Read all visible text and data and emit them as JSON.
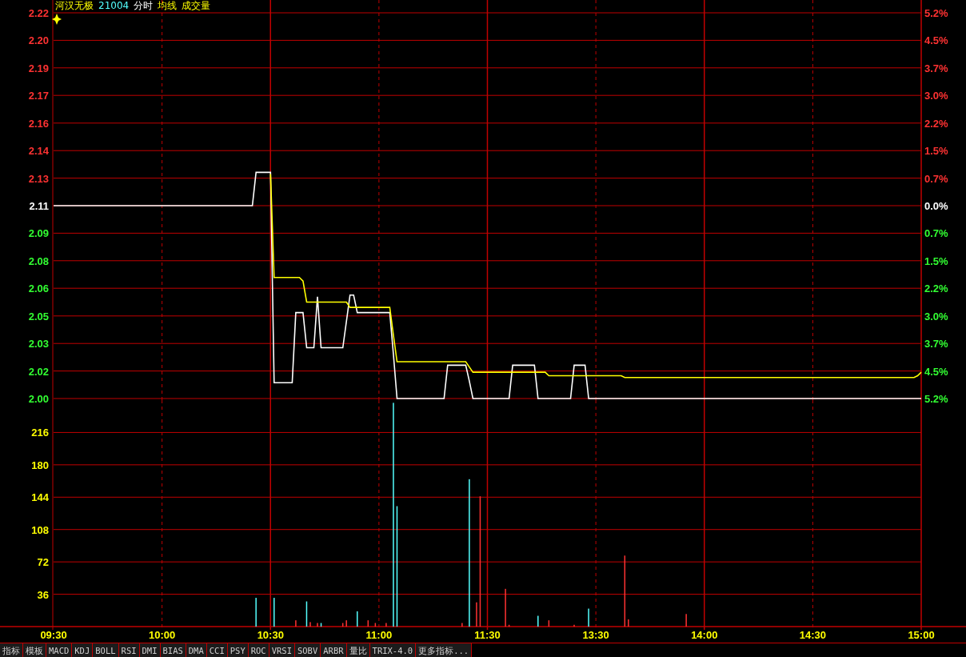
{
  "header": [
    {
      "text": "河汉无极",
      "color": "#ffff00"
    },
    {
      "text": "21004",
      "color": "#54ffff"
    }
  ],
  "price_chart": {
    "percent_labels": [
      "5.2%",
      "4.5%",
      "3.7%",
      "3.0%",
      "2.2%",
      "1.5%",
      "0.7%",
      "0.0%",
      "0.7%",
      "1.5%",
      "2.2%",
      "3.0%",
      "3.7%",
      "4.5%",
      "5.2%"
    ],
    "chart_data": {
      "type": "line",
      "grid": true,
      "categories": [
        null,
        null,
        null,
        null,
        null,
        null,
        null,
        null,
        null,
        null,
        null,
        null,
        null,
        null,
        null,
        null,
        null,
        null,
        null,
        null,
        null,
        null,
        null,
        null,
        null,
        null,
        null,
        null,
        null,
        null,
        null,
        null,
        null,
        null,
        null,
        null,
        null,
        null,
        null,
        null,
        null,
        null,
        null,
        null,
        null,
        null,
        null,
        null,
        null,
        null,
        null,
        null,
        null,
        null,
        null,
        null,
        null,
        null,
        null,
        null,
        null,
        null,
        null,
        null,
        null,
        null,
        null,
        null,
        null,
        null,
        null,
        null,
        null,
        null,
        null,
        null,
        null,
        null,
        null,
        null,
        null,
        null,
        null,
        null,
        null,
        null,
        null,
        null,
        null,
        null,
        null,
        null,
        null,
        null,
        null,
        null,
        null,
        null,
        null,
        null,
        null,
        null,
        null,
        null,
        null,
        null,
        null,
        null,
        null,
        null,
        null,
        null,
        null,
        null,
        null,
        null,
        null,
        null,
        null,
        null,
        null,
        null,
        null,
        null,
        null,
        null,
        null,
        null,
        null,
        null,
        null,
        null,
        null,
        null,
        null,
        null,
        null,
        null,
        null,
        null,
        null,
        null,
        null,
        null,
        null,
        null,
        null,
        null,
        null,
        null,
        null,
        null,
        null,
        null,
        null,
        null,
        null,
        null,
        null,
        null,
        null,
        null,
        null,
        null,
        null,
        null,
        null,
        null,
        null,
        null,
        null,
        null,
        null,
        null,
        null,
        null,
        null,
        null,
        null,
        null,
        null,
        null,
        null,
        null,
        null,
        null,
        null,
        null,
        null,
        null,
        null,
        null,
        null,
        null,
        null,
        null,
        null,
        null,
        null,
        null,
        null,
        null,
        null,
        null,
        null,
        null,
        null,
        null,
        null,
        null,
        null,
        null,
        null,
        null,
        null,
        null,
        null,
        null,
        null,
        null,
        null,
        null,
        null,
        null,
        null,
        null,
        null,
        null,
        null,
        null,
        null,
        null,
        null,
        null,
        null,
        null,
        null,
        null,
        null,
        null,
        null
      ],
      "ylim": [
        2.0,
        2.22
      ],
      "yticks": [
        {
          "value": 2.22,
          "label": "2.22"
        },
        {
          "value": 2.2043,
          "label": "2.20"
        },
        {
          "value": 2.1886,
          "label": "2.19"
        },
        {
          "value": 2.1729,
          "label": "2.17"
        },
        {
          "value": 2.1571,
          "label": "2.16"
        },
        {
          "value": 2.1414,
          "label": "2.14"
        },
        {
          "value": 2.1257,
          "label": "2.13"
        },
        {
          "value": 2.11,
          "label": "2.11"
        },
        {
          "value": 2.0943,
          "label": "2.09"
        },
        {
          "value": 2.0786,
          "label": "2.08"
        },
        {
          "value": 2.0629,
          "label": "2.06"
        },
        {
          "value": 2.0471,
          "label": "2.05"
        },
        {
          "value": 2.0314,
          "label": "2.03"
        },
        {
          "value": 2.0157,
          "label": "2.02"
        },
        {
          "value": 2.0,
          "label": "2.00"
        }
      ],
      "series": [
        {
          "name": "分时",
          "color": "#ffffff",
          "values": [
            2.11,
            2.11,
            2.11,
            2.11,
            2.11,
            2.11,
            2.11,
            2.11,
            2.11,
            2.11,
            2.11,
            2.11,
            2.11,
            2.11,
            2.11,
            2.11,
            2.11,
            2.11,
            2.11,
            2.11,
            2.11,
            2.11,
            2.11,
            2.11,
            2.11,
            2.11,
            2.11,
            2.11,
            2.11,
            2.11,
            2.11,
            2.11,
            2.11,
            2.11,
            2.11,
            2.11,
            2.11,
            2.11,
            2.11,
            2.11,
            2.11,
            2.11,
            2.11,
            2.11,
            2.11,
            2.11,
            2.11,
            2.11,
            2.11,
            2.11,
            2.11,
            2.11,
            2.11,
            2.11,
            2.11,
            2.11,
            2.129,
            2.129,
            2.129,
            2.129,
            2.129,
            2.009,
            2.009,
            2.009,
            2.009,
            2.009,
            2.009,
            2.049,
            2.049,
            2.049,
            2.029,
            2.029,
            2.029,
            2.058,
            2.029,
            2.029,
            2.029,
            2.029,
            2.029,
            2.029,
            2.029,
            2.044,
            2.059,
            2.059,
            2.049,
            2.049,
            2.049,
            2.049,
            2.049,
            2.049,
            2.049,
            2.049,
            2.049,
            2.049,
            2.025,
            2.0,
            2.0,
            2.0,
            2.0,
            2.0,
            2.0,
            2.0,
            2.0,
            2.0,
            2.0,
            2.0,
            2.0,
            2.0,
            2.0,
            2.019,
            2.019,
            2.019,
            2.019,
            2.019,
            2.019,
            2.01,
            2.0,
            2.0,
            2.0,
            2.0,
            2.0,
            2.0,
            2.0,
            2.0,
            2.0,
            2.0,
            2.0,
            2.019,
            2.019,
            2.019,
            2.019,
            2.019,
            2.019,
            2.019,
            2.0,
            2.0,
            2.0,
            2.0,
            2.0,
            2.0,
            2.0,
            2.0,
            2.0,
            2.0,
            2.019,
            2.019,
            2.019,
            2.019,
            2.0,
            2.0,
            2.0,
            2.0,
            2.0,
            2.0,
            2.0,
            2.0,
            2.0,
            2.0,
            2.0,
            2.0,
            2.0,
            2.0,
            2.0,
            2.0,
            2.0,
            2.0,
            2.0,
            2.0,
            2.0,
            2.0,
            2.0,
            2.0,
            2.0,
            2.0,
            2.0,
            2.0,
            2.0,
            2.0,
            2.0,
            2.0,
            2.0,
            2.0,
            2.0,
            2.0,
            2.0,
            2.0,
            2.0,
            2.0,
            2.0,
            2.0,
            2.0,
            2.0,
            2.0,
            2.0,
            2.0,
            2.0,
            2.0,
            2.0,
            2.0,
            2.0,
            2.0,
            2.0,
            2.0,
            2.0,
            2.0,
            2.0,
            2.0,
            2.0,
            2.0,
            2.0,
            2.0,
            2.0,
            2.0,
            2.0,
            2.0,
            2.0,
            2.0,
            2.0,
            2.0,
            2.0,
            2.0,
            2.0,
            2.0,
            2.0,
            2.0,
            2.0,
            2.0,
            2.0,
            2.0,
            2.0,
            2.0,
            2.0,
            2.0,
            2.0,
            2.0,
            2.0,
            2.0,
            2.0,
            2.0,
            2.0,
            2.0
          ]
        },
        {
          "name": "均线",
          "color": "#ffff00",
          "values": [
            null,
            null,
            null,
            null,
            null,
            null,
            null,
            null,
            null,
            null,
            null,
            null,
            null,
            null,
            null,
            null,
            null,
            null,
            null,
            null,
            null,
            null,
            null,
            null,
            null,
            null,
            null,
            null,
            null,
            null,
            null,
            null,
            null,
            null,
            null,
            null,
            null,
            null,
            null,
            null,
            null,
            null,
            null,
            null,
            null,
            null,
            null,
            null,
            null,
            null,
            null,
            null,
            null,
            null,
            null,
            null,
            null,
            null,
            null,
            null,
            2.128,
            2.069,
            2.069,
            2.069,
            2.069,
            2.069,
            2.069,
            2.069,
            2.069,
            2.067,
            2.055,
            2.055,
            2.055,
            2.055,
            2.055,
            2.055,
            2.055,
            2.055,
            2.055,
            2.055,
            2.055,
            2.055,
            2.052,
            2.052,
            2.052,
            2.052,
            2.052,
            2.052,
            2.052,
            2.052,
            2.052,
            2.052,
            2.052,
            2.052,
            2.036,
            2.021,
            2.021,
            2.021,
            2.021,
            2.021,
            2.021,
            2.021,
            2.021,
            2.021,
            2.021,
            2.021,
            2.021,
            2.021,
            2.021,
            2.021,
            2.021,
            2.021,
            2.021,
            2.021,
            2.021,
            2.018,
            2.015,
            2.015,
            2.015,
            2.015,
            2.015,
            2.015,
            2.015,
            2.015,
            2.015,
            2.015,
            2.015,
            2.015,
            2.015,
            2.015,
            2.015,
            2.015,
            2.015,
            2.015,
            2.015,
            2.015,
            2.015,
            2.013,
            2.013,
            2.013,
            2.013,
            2.013,
            2.013,
            2.013,
            2.013,
            2.013,
            2.013,
            2.013,
            2.013,
            2.013,
            2.013,
            2.013,
            2.013,
            2.013,
            2.013,
            2.013,
            2.013,
            2.013,
            2.012,
            2.012,
            2.012,
            2.012,
            2.012,
            2.012,
            2.012,
            2.012,
            2.012,
            2.012,
            2.012,
            2.012,
            2.012,
            2.012,
            2.012,
            2.012,
            2.012,
            2.012,
            2.012,
            2.012,
            2.012,
            2.012,
            2.012,
            2.012,
            2.012,
            2.012,
            2.012,
            2.012,
            2.012,
            2.012,
            2.012,
            2.012,
            2.012,
            2.012,
            2.012,
            2.012,
            2.012,
            2.012,
            2.012,
            2.012,
            2.012,
            2.012,
            2.012,
            2.012,
            2.012,
            2.012,
            2.012,
            2.012,
            2.012,
            2.012,
            2.012,
            2.012,
            2.012,
            2.012,
            2.012,
            2.012,
            2.012,
            2.012,
            2.012,
            2.012,
            2.012,
            2.012,
            2.012,
            2.012,
            2.012,
            2.012,
            2.012,
            2.012,
            2.012,
            2.012,
            2.012,
            2.012,
            2.012,
            2.012,
            2.012,
            2.012,
            2.012,
            2.012,
            2.012,
            2.012,
            2.012,
            2.013,
            2.015
          ]
        }
      ]
    }
  },
  "volume_chart": {
    "chart_data": {
      "type": "bar",
      "title": "成交量",
      "grid": true,
      "categories": [
        "09:30",
        null,
        null,
        null,
        null,
        null,
        null,
        null,
        null,
        null,
        null,
        null,
        null,
        null,
        null,
        null,
        null,
        null,
        null,
        null,
        null,
        null,
        null,
        null,
        null,
        null,
        null,
        null,
        null,
        null,
        "10:00",
        null,
        null,
        null,
        null,
        null,
        null,
        null,
        null,
        null,
        null,
        null,
        null,
        null,
        null,
        null,
        null,
        null,
        null,
        null,
        null,
        null,
        null,
        null,
        null,
        null,
        null,
        null,
        null,
        null,
        "10:30",
        null,
        null,
        null,
        null,
        null,
        null,
        null,
        null,
        null,
        null,
        null,
        null,
        null,
        null,
        null,
        null,
        null,
        null,
        null,
        null,
        null,
        null,
        null,
        null,
        null,
        null,
        null,
        null,
        null,
        "11:00",
        null,
        null,
        null,
        null,
        null,
        null,
        null,
        null,
        null,
        null,
        null,
        null,
        null,
        null,
        null,
        null,
        null,
        null,
        null,
        null,
        null,
        null,
        null,
        null,
        null,
        null,
        null,
        null,
        null,
        "11:30",
        null,
        null,
        null,
        null,
        null,
        null,
        null,
        null,
        null,
        null,
        null,
        null,
        null,
        null,
        null,
        null,
        null,
        null,
        null,
        null,
        null,
        null,
        null,
        null,
        null,
        null,
        null,
        null,
        null,
        "13:30",
        null,
        null,
        null,
        null,
        null,
        null,
        null,
        null,
        null,
        null,
        null,
        null,
        null,
        null,
        null,
        null,
        null,
        null,
        null,
        null,
        null,
        null,
        null,
        null,
        null,
        null,
        null,
        null,
        null,
        "14:00",
        null,
        null,
        null,
        null,
        null,
        null,
        null,
        null,
        null,
        null,
        null,
        null,
        null,
        null,
        null,
        null,
        null,
        null,
        null,
        null,
        null,
        null,
        null,
        null,
        null,
        null,
        null,
        null,
        null,
        "14:30",
        null,
        null,
        null,
        null,
        null,
        null,
        null,
        null,
        null,
        null,
        null,
        null,
        null,
        null,
        null,
        null,
        null,
        null,
        null,
        null,
        null,
        null,
        null,
        null,
        null,
        null,
        null,
        null,
        null,
        "15:00"
      ],
      "ylim": [
        0,
        252
      ],
      "yticks": [
        36,
        72,
        108,
        144,
        180,
        216
      ],
      "series": [
        {
          "color": "#ff3232",
          "values": [
            null,
            null,
            null,
            null,
            null,
            null,
            null,
            null,
            null,
            null,
            null,
            null,
            null,
            null,
            null,
            null,
            null,
            null,
            null,
            null,
            null,
            null,
            null,
            null,
            null,
            null,
            null,
            null,
            null,
            null,
            null,
            null,
            null,
            null,
            null,
            null,
            null,
            null,
            null,
            null,
            null,
            null,
            null,
            null,
            null,
            null,
            null,
            null,
            null,
            null,
            null,
            null,
            null,
            null,
            null,
            null,
            null,
            null,
            null,
            null,
            null,
            null,
            null,
            null,
            null,
            null,
            null,
            7,
            null,
            null,
            null,
            5,
            null,
            4,
            null,
            null,
            null,
            null,
            null,
            null,
            4,
            7,
            null,
            null,
            null,
            null,
            null,
            7,
            null,
            4,
            null,
            null,
            4,
            null,
            null,
            null,
            null,
            null,
            null,
            null,
            null,
            null,
            null,
            null,
            null,
            null,
            null,
            null,
            null,
            null,
            null,
            null,
            null,
            4,
            null,
            null,
            null,
            27,
            145,
            null,
            null,
            null,
            null,
            null,
            null,
            42,
            2,
            null,
            null,
            null,
            null,
            null,
            null,
            null,
            null,
            null,
            null,
            7,
            null,
            null,
            null,
            null,
            null,
            null,
            2,
            null,
            null,
            null,
            null,
            null,
            null,
            null,
            null,
            null,
            null,
            null,
            null,
            null,
            79,
            8,
            null,
            null,
            null,
            null,
            null,
            null,
            null,
            null,
            null,
            null,
            null,
            null,
            null,
            null,
            null,
            14,
            null,
            null,
            null,
            null,
            null,
            null,
            null,
            null,
            null,
            null,
            null,
            null,
            null,
            null,
            null,
            null,
            null,
            null,
            null,
            null,
            null,
            null,
            null,
            null,
            null,
            null,
            null,
            null,
            null,
            null,
            null,
            null,
            null,
            null,
            null,
            null,
            null,
            null,
            null,
            null,
            null,
            null,
            null,
            null,
            null,
            null,
            null,
            null,
            null,
            null,
            null,
            null,
            null,
            null,
            null,
            null,
            null,
            null,
            null,
            null,
            null,
            null,
            null,
            null,
            null
          ]
        },
        {
          "color": "#54ffff",
          "values": [
            null,
            null,
            null,
            null,
            null,
            null,
            null,
            null,
            null,
            null,
            null,
            null,
            null,
            null,
            null,
            null,
            null,
            null,
            null,
            null,
            null,
            null,
            null,
            null,
            null,
            null,
            null,
            null,
            null,
            null,
            null,
            null,
            null,
            null,
            null,
            null,
            null,
            null,
            null,
            null,
            null,
            null,
            null,
            null,
            null,
            null,
            null,
            null,
            null,
            null,
            null,
            null,
            null,
            null,
            null,
            null,
            32,
            null,
            null,
            null,
            null,
            32,
            null,
            null,
            null,
            null,
            null,
            null,
            null,
            null,
            28,
            null,
            null,
            null,
            4,
            null,
            null,
            null,
            null,
            null,
            null,
            null,
            null,
            null,
            17,
            null,
            null,
            null,
            null,
            null,
            null,
            null,
            null,
            null,
            249,
            134,
            null,
            null,
            null,
            null,
            null,
            null,
            null,
            null,
            null,
            null,
            null,
            null,
            null,
            null,
            null,
            null,
            null,
            null,
            null,
            164,
            null,
            null,
            null,
            null,
            null,
            null,
            null,
            null,
            null,
            null,
            null,
            null,
            null,
            null,
            null,
            null,
            null,
            null,
            12,
            null,
            null,
            null,
            null,
            null,
            null,
            null,
            null,
            null,
            null,
            null,
            null,
            null,
            20,
            null,
            null,
            null,
            null,
            null,
            null,
            null,
            null,
            null,
            null,
            null,
            null,
            null,
            null,
            null,
            null,
            null,
            null,
            null,
            null,
            null,
            null,
            null,
            null,
            null,
            null,
            null,
            null,
            null,
            null,
            null,
            null,
            null,
            null,
            null,
            null,
            null,
            null,
            null,
            null,
            null,
            null,
            null,
            null,
            null,
            null,
            null,
            null,
            null,
            null,
            null,
            null,
            null,
            null,
            null,
            null,
            null,
            null,
            null,
            null,
            null,
            null,
            null,
            null,
            null,
            null,
            null,
            null,
            null,
            null,
            null,
            null,
            null,
            null,
            null,
            null,
            null,
            null,
            null,
            null,
            null,
            null,
            null,
            null,
            null,
            null,
            null,
            null,
            null,
            null,
            null,
            null
          ]
        }
      ]
    }
  },
  "tabs": [
    "指标",
    "模板",
    "MACD",
    "KDJ",
    "BOLL",
    "RSI",
    "DMI",
    "BIAS",
    "DMA",
    "CCI",
    "PSY",
    "ROC",
    "VRSI",
    "SOBV",
    "ARBR",
    "量比",
    "TRIX-4.0",
    "更多指标..."
  ]
}
